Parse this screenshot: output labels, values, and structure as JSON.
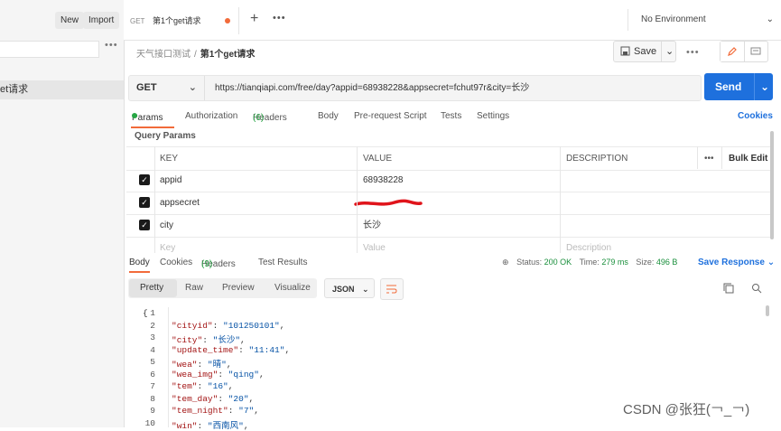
{
  "sidebar": {
    "new_label": "New",
    "import_label": "Import",
    "item_label": "et请求"
  },
  "tabbar": {
    "tab_method": "GET",
    "tab_title": "第1个get请求",
    "env_label": "No Environment"
  },
  "breadcrumb": {
    "parent": "天气接口测试",
    "sep": "/",
    "current": "第1个get请求"
  },
  "toolbar": {
    "save_label": "Save"
  },
  "request": {
    "method": "GET",
    "url": "https://tianqiapi.com/free/day?appid=68938228&appsecret=fchut97r&city=长沙",
    "send_label": "Send"
  },
  "req_tabs": {
    "params": "Params",
    "authorization": "Authorization",
    "headers": "Headers",
    "headers_count": "(6)",
    "body": "Body",
    "prerequest": "Pre-request Script",
    "tests": "Tests",
    "settings": "Settings",
    "cookies": "Cookies"
  },
  "query_params": {
    "title": "Query Params",
    "columns": {
      "key": "KEY",
      "value": "VALUE",
      "description": "DESCRIPTION",
      "bulk": "Bulk Edit"
    },
    "rows": [
      {
        "key": "appid",
        "value": "68938228"
      },
      {
        "key": "appsecret",
        "value": ""
      },
      {
        "key": "city",
        "value": "长沙"
      }
    ],
    "placeholders": {
      "key": "Key",
      "value": "Value",
      "description": "Description"
    }
  },
  "response": {
    "tabs": {
      "body": "Body",
      "cookies": "Cookies",
      "headers": "Headers",
      "headers_count": "(9)",
      "results": "Test Results"
    },
    "status_label": "Status:",
    "status_value": "200 OK",
    "time_label": "Time:",
    "time_value": "279 ms",
    "size_label": "Size:",
    "size_value": "496 B",
    "save_response": "Save Response",
    "view_modes": [
      "Pretty",
      "Raw",
      "Preview",
      "Visualize"
    ],
    "format": "JSON"
  },
  "code_lines": [
    {
      "n": "1",
      "key": "",
      "val": "",
      "raw": "{"
    },
    {
      "n": "2",
      "key": "\"cityid\"",
      "val": "\"101250101\""
    },
    {
      "n": "3",
      "key": "\"city\"",
      "val": "\"长沙\""
    },
    {
      "n": "4",
      "key": "\"update_time\"",
      "val": "\"11:41\""
    },
    {
      "n": "5",
      "key": "\"wea\"",
      "val": "\"晴\""
    },
    {
      "n": "6",
      "key": "\"wea_img\"",
      "val": "\"qing\""
    },
    {
      "n": "7",
      "key": "\"tem\"",
      "val": "\"16\""
    },
    {
      "n": "8",
      "key": "\"tem_day\"",
      "val": "\"20\""
    },
    {
      "n": "9",
      "key": "\"tem_night\"",
      "val": "\"7\""
    },
    {
      "n": "10",
      "key": "\"win\"",
      "val": "\"西南风\""
    }
  ],
  "watermark": "CSDN @张狂(￢_￢)",
  "colors": {
    "accent": "#f26b3a",
    "send": "#1e70dd",
    "ok": "#1a8f3c"
  }
}
